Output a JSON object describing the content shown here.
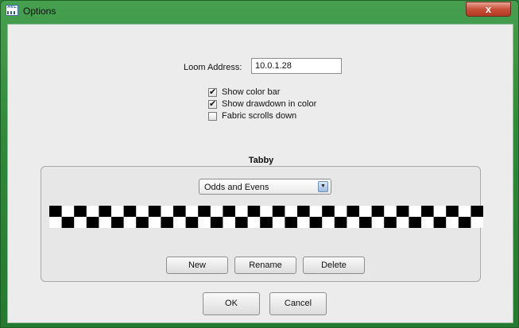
{
  "window": {
    "title": "Options",
    "icon_text": "AVL",
    "close_label": "x"
  },
  "loom": {
    "label": "Loom Address:",
    "value": "10.0.1.28"
  },
  "checkboxes": [
    {
      "label": "Show color bar",
      "checked": true
    },
    {
      "label": "Show drawdown in color",
      "checked": true
    },
    {
      "label": "Fabric scrolls down",
      "checked": false
    }
  ],
  "tabby": {
    "title": "Tabby",
    "selected": "Odds and Evens",
    "pattern": {
      "columns": 35,
      "rows": 2,
      "dark": "#000000",
      "light": "#ffffff"
    },
    "buttons": {
      "new": "New",
      "rename": "Rename",
      "delete": "Delete"
    }
  },
  "dialog_buttons": {
    "ok": "OK",
    "cancel": "Cancel"
  },
  "colors": {
    "frame": "#2f8a3a",
    "client": "#ececec",
    "close": "#c9513a"
  },
  "icons": {
    "app": "avl-app-icon",
    "close": "close-icon",
    "dropdown": "dropdown-arrow-icon",
    "check": "check-icon"
  }
}
